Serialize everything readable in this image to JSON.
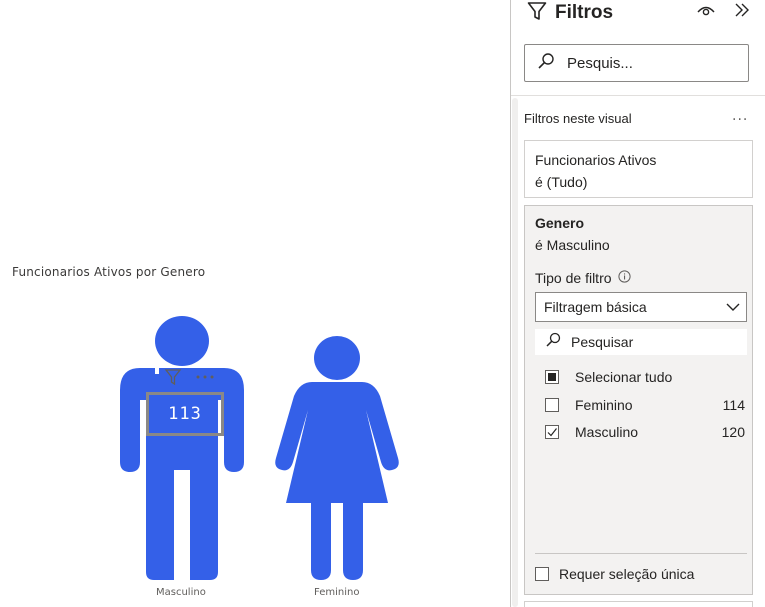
{
  "canvas": {
    "visual_title": "Funcionarios Ativos por Genero",
    "count_value": "113",
    "figures": [
      {
        "label": "Masculino"
      },
      {
        "label": "Feminino"
      }
    ],
    "colors": {
      "figure_fill": "#3460E8"
    }
  },
  "pane": {
    "title": "Filtros",
    "search_placeholder": "Pesquis...",
    "section_label": "Filtros neste visual",
    "more_label": "...",
    "filters": [
      {
        "field": "Funcionarios Ativos",
        "condition": "é (Tudo)"
      },
      {
        "field": "Genero",
        "condition": "é Masculino"
      }
    ],
    "filter_type_label": "Tipo de filtro",
    "filter_type_value": "Filtragem básica",
    "inner_search_placeholder": "Pesquisar",
    "select_all": "Selecionar tudo",
    "options": [
      {
        "label": "Feminino",
        "count": "114",
        "checked": false
      },
      {
        "label": "Masculino",
        "count": "120",
        "checked": true
      }
    ],
    "single_select_label": "Requer seleção única"
  }
}
